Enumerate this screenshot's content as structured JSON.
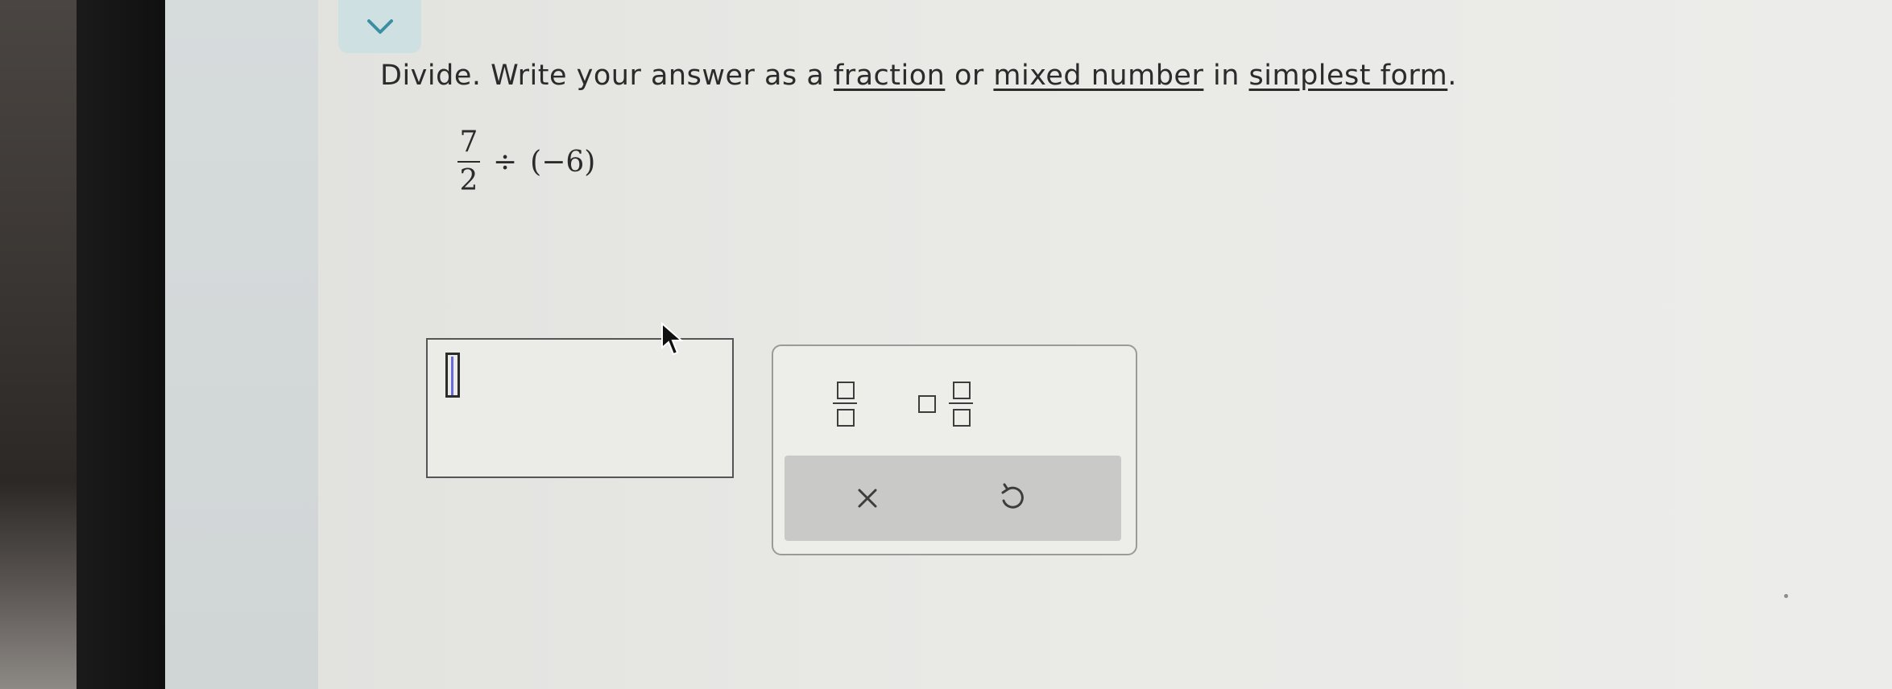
{
  "prompt": {
    "lead": "Divide. Write your answer as a ",
    "link1": "fraction",
    "mid1": " or ",
    "link2": "mixed number",
    "mid2": " in ",
    "link3": "simplest form",
    "end": "."
  },
  "expression": {
    "numerator": "7",
    "denominator": "2",
    "operator": "÷",
    "operand": "(−6)"
  },
  "answer": {
    "value": ""
  },
  "keypad": {
    "keys": [
      "fraction-template",
      "mixed-number-template"
    ],
    "actions": [
      "clear",
      "undo"
    ]
  },
  "icons": {
    "collapse": "chevron-down-icon",
    "clear": "close-icon",
    "undo": "undo-icon",
    "pointer": "mouse-pointer-icon"
  }
}
